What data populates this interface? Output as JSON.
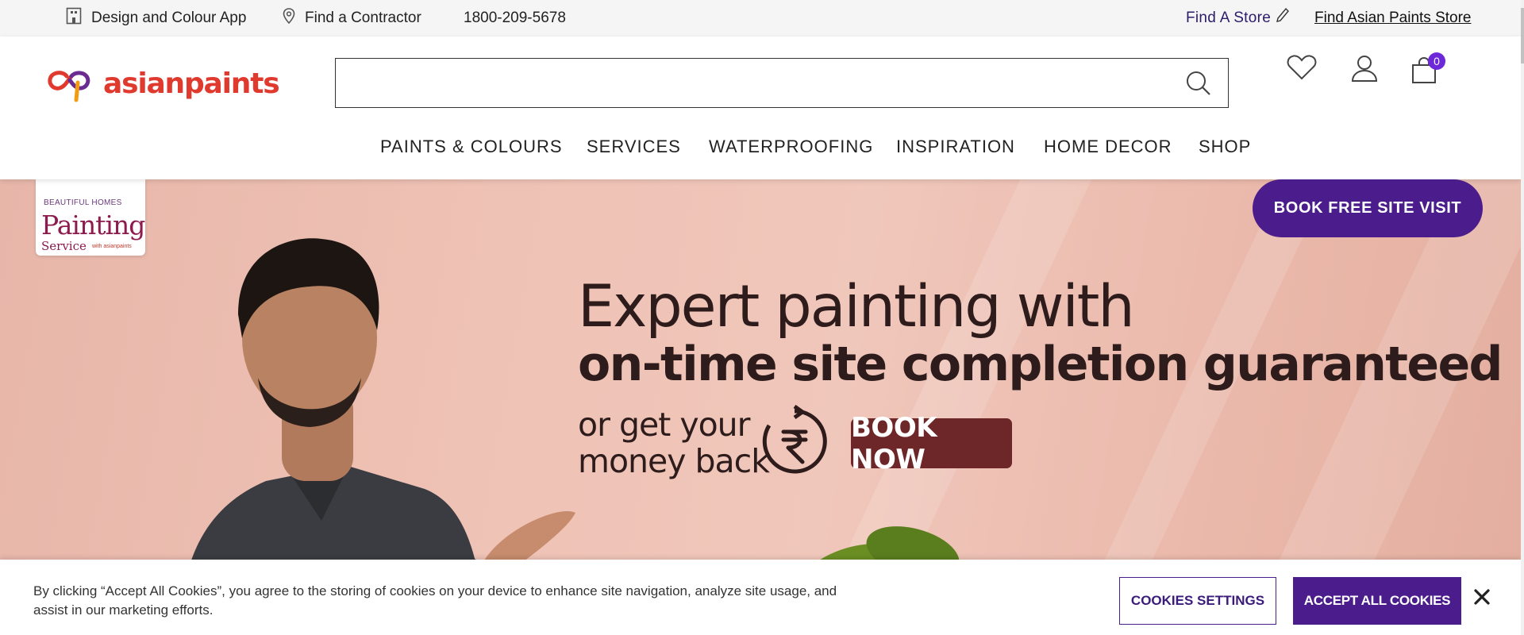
{
  "topbar": {
    "design_app": "Design and Colour App",
    "find_contractor": "Find a Contractor",
    "phone": "1800-209-5678",
    "find_store": "Find A Store",
    "find_ap_store": "Find Asian Paints Store"
  },
  "header": {
    "logo_text": "asianpaints",
    "search": {
      "value": "",
      "placeholder": ""
    },
    "cart_count": "0"
  },
  "nav": {
    "items": [
      "PAINTS & COLOURS",
      "SERVICES",
      "WATERPROOFING",
      "INSPIRATION",
      "HOME DECOR",
      "SHOP"
    ]
  },
  "hero": {
    "badge": {
      "brand_line": "BEAUTIFUL HOMES",
      "title": "Painting",
      "subtitle": "Service",
      "tagline": "with asianpaints"
    },
    "book_site_visit": "BOOK FREE SITE VISIT",
    "headline1": "Expert painting with",
    "headline2": "on-time site completion guaranteed",
    "money_line1": "or get your",
    "money_line2": "money back",
    "book_now": "BOOK NOW"
  },
  "cookie": {
    "message": "By clicking “Accept All Cookies”, you agree to the storing of cookies on your device to enhance site navigation, analyze site usage, and assist in our marketing efforts.",
    "settings_label": "COOKIES SETTINGS",
    "accept_label": "ACCEPT ALL COOKIES"
  },
  "colors": {
    "brand_purple": "#4b1d8c",
    "brand_red": "#e03a2f",
    "hero_bg": "#efc3b6",
    "book_now_bg": "#6e2729"
  },
  "icons": [
    "building-icon",
    "location-pin-icon",
    "pencil-icon",
    "search-icon",
    "heart-icon",
    "user-icon",
    "cart-icon",
    "rupee-icon",
    "close-icon"
  ]
}
